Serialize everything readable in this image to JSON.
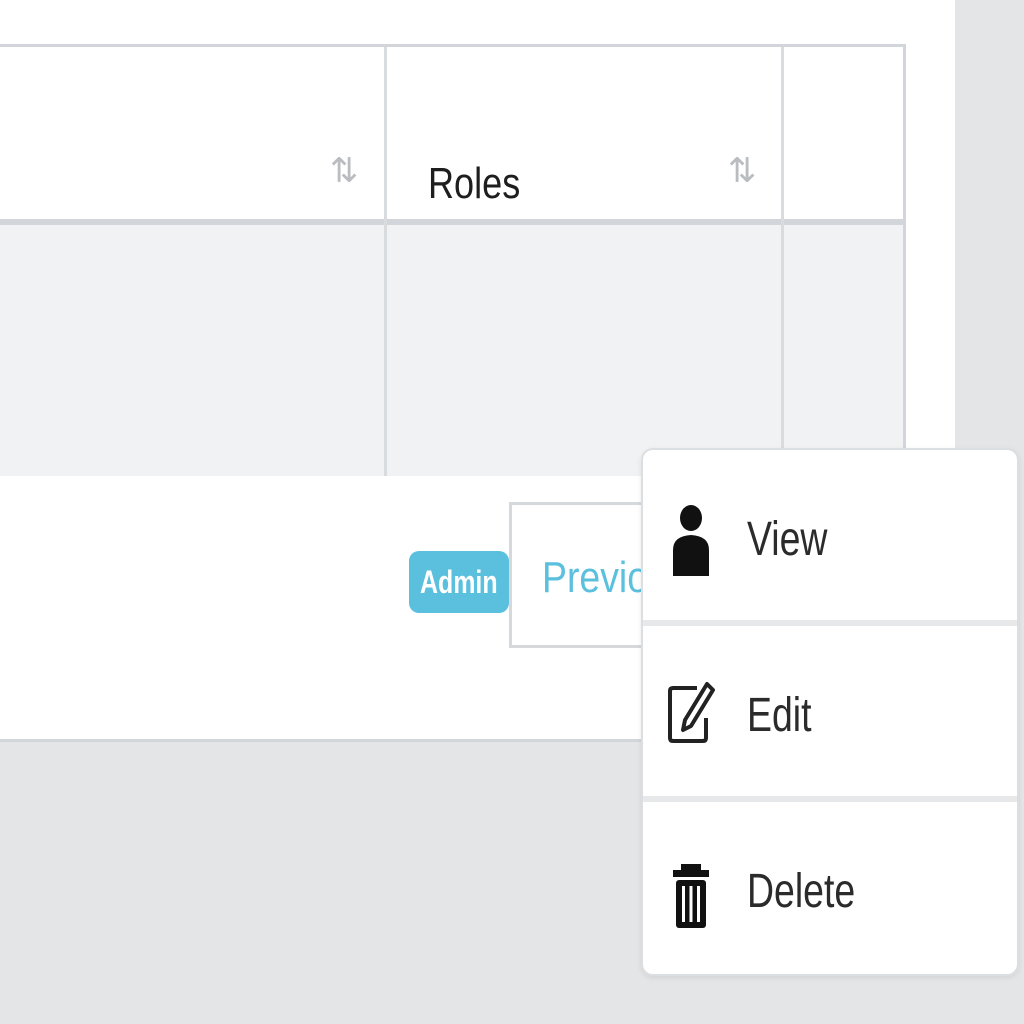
{
  "table": {
    "columns": [
      {
        "label": "",
        "sortable": true
      },
      {
        "label": "Roles",
        "sortable": true
      },
      {
        "label": "",
        "sortable": false
      }
    ],
    "rows": [
      {
        "role_badge": "Admin"
      }
    ]
  },
  "pagination": {
    "previous_label": "Previous"
  },
  "row_menu": {
    "items": [
      {
        "label": "View",
        "icon": "user-icon"
      },
      {
        "label": "Edit",
        "icon": "edit-icon"
      },
      {
        "label": "Delete",
        "icon": "trash-icon"
      }
    ]
  },
  "colors": {
    "accent": "#5bc0de",
    "background": "#e4e5e7",
    "row_background": "#f1f2f3"
  }
}
